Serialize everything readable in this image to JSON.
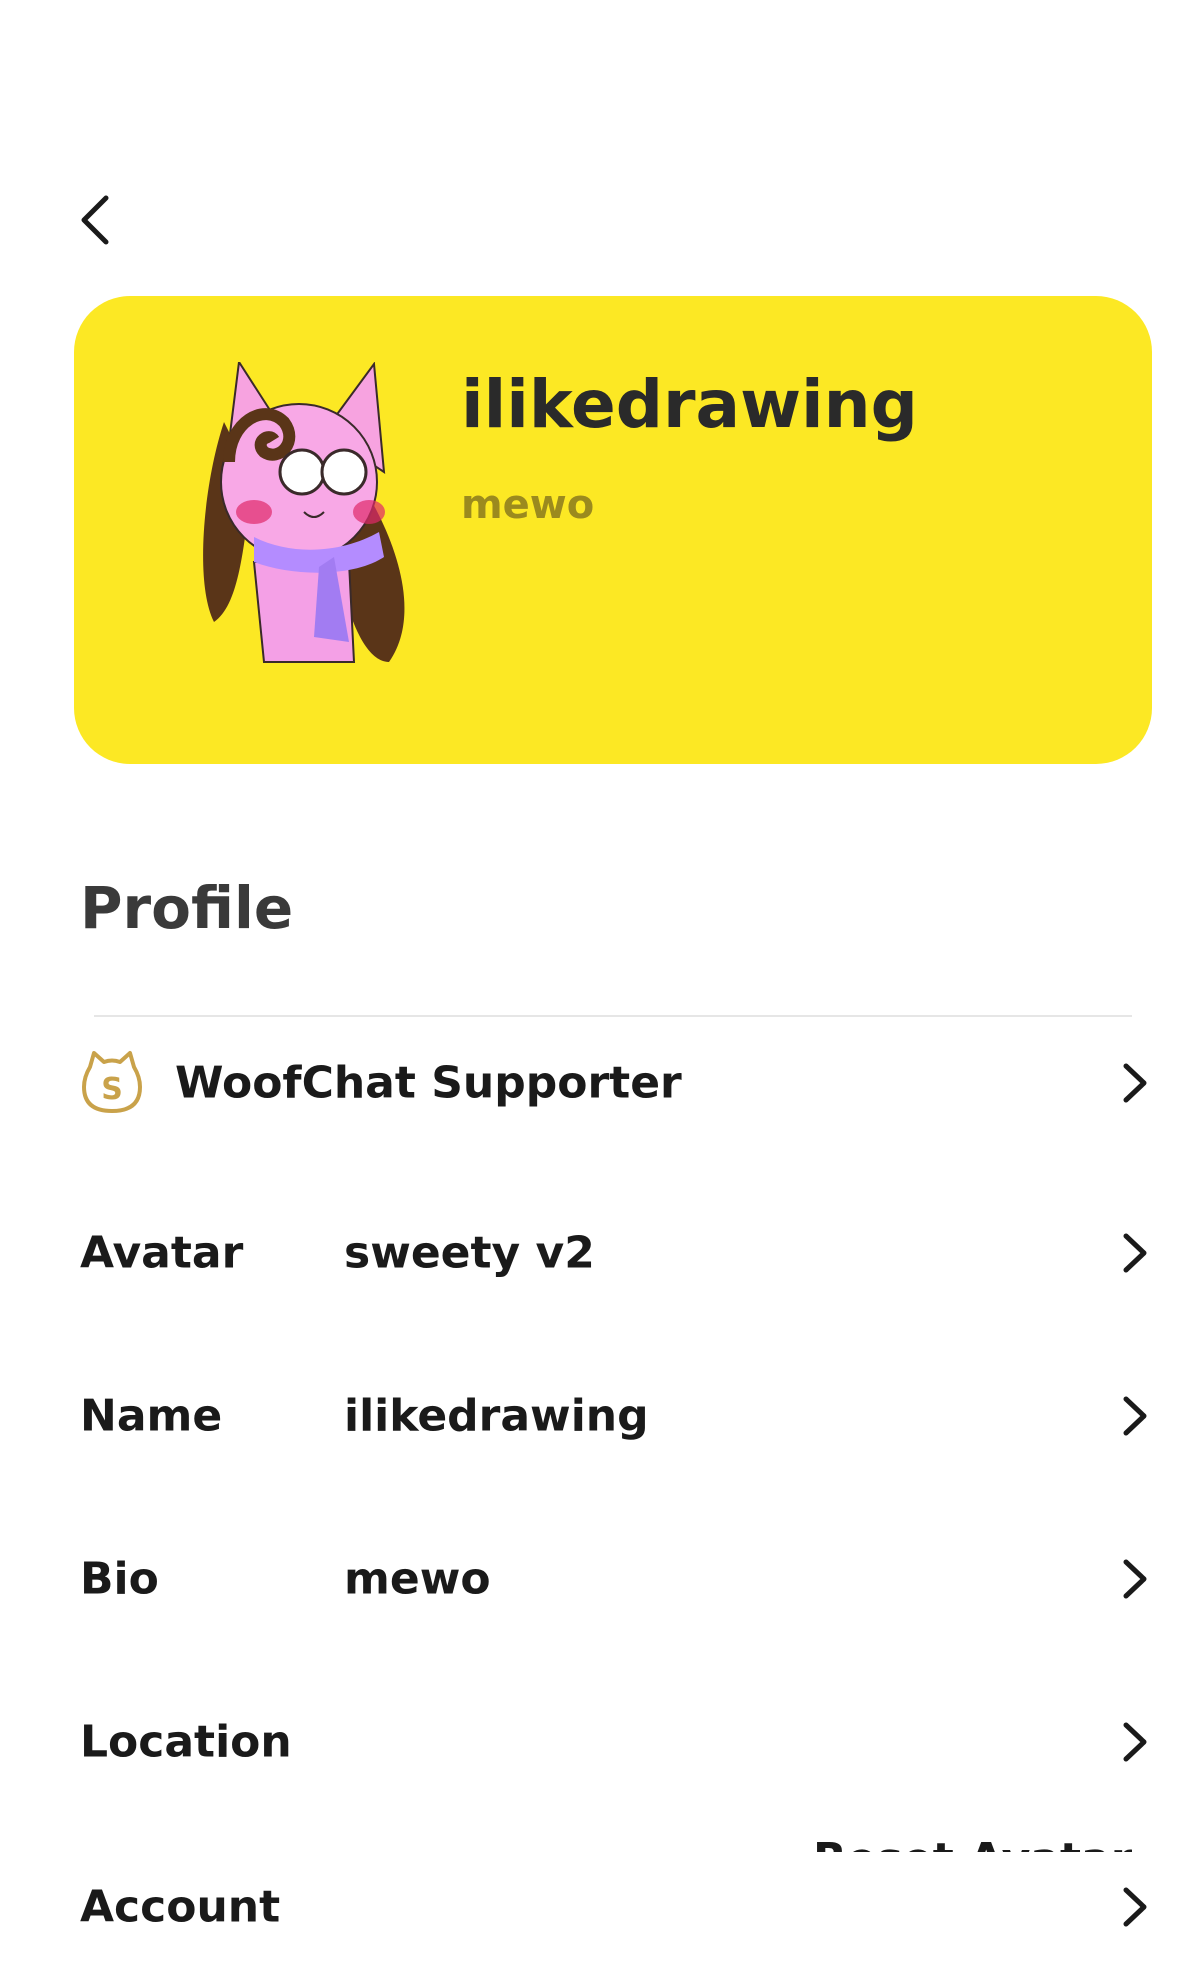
{
  "header": {
    "back_icon": "chevron-left-icon"
  },
  "profile_card": {
    "name": "ilikedrawing",
    "bio": "mewo",
    "background_color": "#fce824",
    "bio_color": "#9b8a1e",
    "avatar": "pink-cat-avatar"
  },
  "section": {
    "title": "Profile"
  },
  "supporter": {
    "label": "WoofChat Supporter",
    "icon": "supporter-coin-icon",
    "icon_color": "#c9a24a"
  },
  "rows": [
    {
      "label": "Avatar",
      "value": "sweety v2"
    },
    {
      "label": "Name",
      "value": "ilikedrawing"
    },
    {
      "label": "Bio",
      "value": "mewo"
    },
    {
      "label": "Location",
      "value": ""
    },
    {
      "label": "Account",
      "value": ""
    }
  ],
  "popup": {
    "reset_avatar": "Reset Avatar"
  }
}
